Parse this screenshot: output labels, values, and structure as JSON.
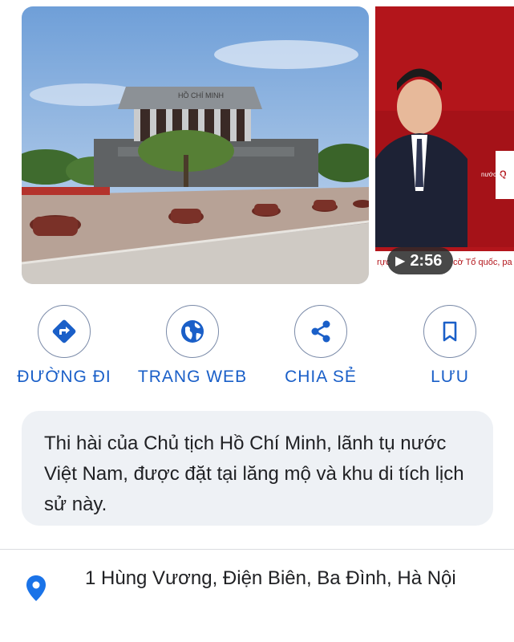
{
  "media": {
    "main_photo_caption_text": "HỒ CHÍ MINH",
    "video": {
      "duration": "2:56",
      "ticker_text": "nước cộ",
      "ticker_text_2": "cờ Tổ quốc, pa"
    }
  },
  "actions": [
    {
      "label": "ĐƯỜNG ĐI",
      "icon": "directions-icon"
    },
    {
      "label": "TRANG WEB",
      "icon": "globe-icon"
    },
    {
      "label": "CHIA SẺ",
      "icon": "share-icon"
    },
    {
      "label": "LƯU",
      "icon": "bookmark-icon"
    }
  ],
  "description": "Thi hài của Chủ tịch Hồ Chí Minh, lãnh tụ nước Việt Nam, được đặt tại lăng mộ và khu di tích lịch sử này.",
  "address": "1 Hùng Vương, Điện Biên, Ba Đình, Hà Nội",
  "colors": {
    "accent": "#1a5fc8",
    "pin": "#1a73e8",
    "card_bg": "#eef1f5",
    "video_bg": "#b11b1b"
  }
}
